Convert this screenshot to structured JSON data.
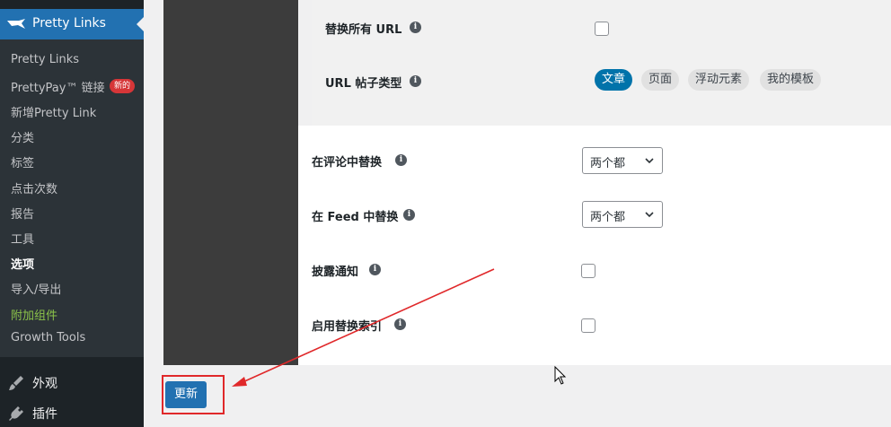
{
  "sidebar": {
    "plugin_title": "Pretty Links",
    "items": [
      {
        "label": "Pretty Links"
      },
      {
        "label": "PrettyPay™ 链接",
        "badge": "新的"
      },
      {
        "label": "新增Pretty Link"
      },
      {
        "label": "分类"
      },
      {
        "label": "标签"
      },
      {
        "label": "点击次数"
      },
      {
        "label": "报告"
      },
      {
        "label": "工具"
      },
      {
        "label": "选项",
        "current": true
      },
      {
        "label": "导入/导出"
      },
      {
        "label": "附加组件",
        "color": "#8bc34a"
      },
      {
        "label": "Growth Tools"
      }
    ],
    "top_items": [
      {
        "label": "外观",
        "icon": "paintbrush-icon"
      },
      {
        "label": "插件",
        "icon": "plugin-icon"
      }
    ]
  },
  "settings": {
    "replace_all_url": {
      "label": "替换所有 URL",
      "checked": false
    },
    "url_post_types": {
      "label": "URL 帖子类型",
      "options": [
        "文章",
        "页面",
        "浮动元素",
        "我的模板"
      ],
      "selected": "文章"
    },
    "replace_in_comments": {
      "label": "在评论中替换",
      "value": "两个都"
    },
    "replace_in_feed": {
      "label": "在 Feed 中替换",
      "value": "两个都"
    },
    "disclosure_notice": {
      "label": "披露通知",
      "checked": false
    },
    "enable_replace_index": {
      "label": "启用替换索引",
      "checked": false
    }
  },
  "actions": {
    "update_label": "更新"
  },
  "colors": {
    "accent": "#2271b1",
    "annotation": "#e0282a",
    "addon_green": "#8bc34a"
  }
}
